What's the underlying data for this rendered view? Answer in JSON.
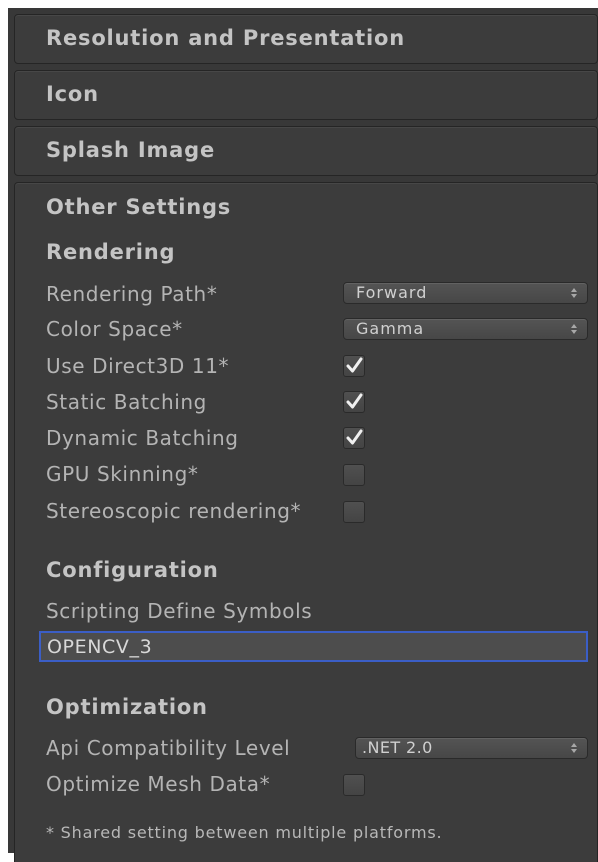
{
  "foldouts": {
    "resolution": "Resolution and Presentation",
    "icon": "Icon",
    "splash": "Splash Image",
    "other": "Other Settings"
  },
  "rendering": {
    "header": "Rendering",
    "rendering_path": {
      "label": "Rendering Path*",
      "value": "Forward"
    },
    "color_space": {
      "label": "Color Space*",
      "value": "Gamma"
    },
    "use_d3d11": {
      "label": "Use Direct3D 11*",
      "checked": true
    },
    "static_batching": {
      "label": "Static Batching",
      "checked": true
    },
    "dynamic_batching": {
      "label": "Dynamic Batching",
      "checked": true
    },
    "gpu_skinning": {
      "label": "GPU Skinning*",
      "checked": false
    },
    "stereoscopic": {
      "label": "Stereoscopic rendering*",
      "checked": false
    }
  },
  "configuration": {
    "header": "Configuration",
    "scripting_define_symbols": {
      "label": "Scripting Define Symbols",
      "value": "OPENCV_3"
    }
  },
  "optimization": {
    "header": "Optimization",
    "api_compat": {
      "label": "Api Compatibility Level",
      "value": ".NET 2.0"
    },
    "optimize_mesh": {
      "label": "Optimize Mesh Data*",
      "checked": false
    }
  },
  "footnote": "* Shared setting between multiple platforms.",
  "colors": {
    "panel_bg": "#383838",
    "text": "#b4b4b4",
    "focus_border": "#3b5ec6",
    "checkmark": "#f0f0f0"
  }
}
